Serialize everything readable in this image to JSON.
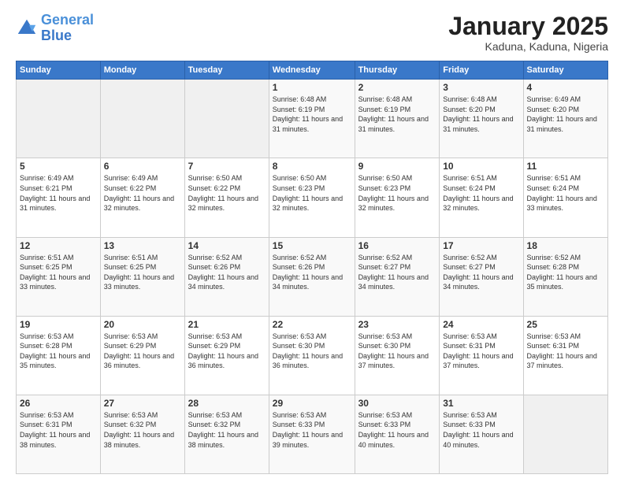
{
  "header": {
    "logo_general": "General",
    "logo_blue": "Blue",
    "title": "January 2025",
    "subtitle": "Kaduna, Kaduna, Nigeria"
  },
  "weekdays": [
    "Sunday",
    "Monday",
    "Tuesday",
    "Wednesday",
    "Thursday",
    "Friday",
    "Saturday"
  ],
  "weeks": [
    [
      {
        "day": "",
        "info": ""
      },
      {
        "day": "",
        "info": ""
      },
      {
        "day": "",
        "info": ""
      },
      {
        "day": "1",
        "info": "Sunrise: 6:48 AM\nSunset: 6:19 PM\nDaylight: 11 hours and 31 minutes."
      },
      {
        "day": "2",
        "info": "Sunrise: 6:48 AM\nSunset: 6:19 PM\nDaylight: 11 hours and 31 minutes."
      },
      {
        "day": "3",
        "info": "Sunrise: 6:48 AM\nSunset: 6:20 PM\nDaylight: 11 hours and 31 minutes."
      },
      {
        "day": "4",
        "info": "Sunrise: 6:49 AM\nSunset: 6:20 PM\nDaylight: 11 hours and 31 minutes."
      }
    ],
    [
      {
        "day": "5",
        "info": "Sunrise: 6:49 AM\nSunset: 6:21 PM\nDaylight: 11 hours and 31 minutes."
      },
      {
        "day": "6",
        "info": "Sunrise: 6:49 AM\nSunset: 6:22 PM\nDaylight: 11 hours and 32 minutes."
      },
      {
        "day": "7",
        "info": "Sunrise: 6:50 AM\nSunset: 6:22 PM\nDaylight: 11 hours and 32 minutes."
      },
      {
        "day": "8",
        "info": "Sunrise: 6:50 AM\nSunset: 6:23 PM\nDaylight: 11 hours and 32 minutes."
      },
      {
        "day": "9",
        "info": "Sunrise: 6:50 AM\nSunset: 6:23 PM\nDaylight: 11 hours and 32 minutes."
      },
      {
        "day": "10",
        "info": "Sunrise: 6:51 AM\nSunset: 6:24 PM\nDaylight: 11 hours and 32 minutes."
      },
      {
        "day": "11",
        "info": "Sunrise: 6:51 AM\nSunset: 6:24 PM\nDaylight: 11 hours and 33 minutes."
      }
    ],
    [
      {
        "day": "12",
        "info": "Sunrise: 6:51 AM\nSunset: 6:25 PM\nDaylight: 11 hours and 33 minutes."
      },
      {
        "day": "13",
        "info": "Sunrise: 6:51 AM\nSunset: 6:25 PM\nDaylight: 11 hours and 33 minutes."
      },
      {
        "day": "14",
        "info": "Sunrise: 6:52 AM\nSunset: 6:26 PM\nDaylight: 11 hours and 34 minutes."
      },
      {
        "day": "15",
        "info": "Sunrise: 6:52 AM\nSunset: 6:26 PM\nDaylight: 11 hours and 34 minutes."
      },
      {
        "day": "16",
        "info": "Sunrise: 6:52 AM\nSunset: 6:27 PM\nDaylight: 11 hours and 34 minutes."
      },
      {
        "day": "17",
        "info": "Sunrise: 6:52 AM\nSunset: 6:27 PM\nDaylight: 11 hours and 34 minutes."
      },
      {
        "day": "18",
        "info": "Sunrise: 6:52 AM\nSunset: 6:28 PM\nDaylight: 11 hours and 35 minutes."
      }
    ],
    [
      {
        "day": "19",
        "info": "Sunrise: 6:53 AM\nSunset: 6:28 PM\nDaylight: 11 hours and 35 minutes."
      },
      {
        "day": "20",
        "info": "Sunrise: 6:53 AM\nSunset: 6:29 PM\nDaylight: 11 hours and 36 minutes."
      },
      {
        "day": "21",
        "info": "Sunrise: 6:53 AM\nSunset: 6:29 PM\nDaylight: 11 hours and 36 minutes."
      },
      {
        "day": "22",
        "info": "Sunrise: 6:53 AM\nSunset: 6:30 PM\nDaylight: 11 hours and 36 minutes."
      },
      {
        "day": "23",
        "info": "Sunrise: 6:53 AM\nSunset: 6:30 PM\nDaylight: 11 hours and 37 minutes."
      },
      {
        "day": "24",
        "info": "Sunrise: 6:53 AM\nSunset: 6:31 PM\nDaylight: 11 hours and 37 minutes."
      },
      {
        "day": "25",
        "info": "Sunrise: 6:53 AM\nSunset: 6:31 PM\nDaylight: 11 hours and 37 minutes."
      }
    ],
    [
      {
        "day": "26",
        "info": "Sunrise: 6:53 AM\nSunset: 6:31 PM\nDaylight: 11 hours and 38 minutes."
      },
      {
        "day": "27",
        "info": "Sunrise: 6:53 AM\nSunset: 6:32 PM\nDaylight: 11 hours and 38 minutes."
      },
      {
        "day": "28",
        "info": "Sunrise: 6:53 AM\nSunset: 6:32 PM\nDaylight: 11 hours and 38 minutes."
      },
      {
        "day": "29",
        "info": "Sunrise: 6:53 AM\nSunset: 6:33 PM\nDaylight: 11 hours and 39 minutes."
      },
      {
        "day": "30",
        "info": "Sunrise: 6:53 AM\nSunset: 6:33 PM\nDaylight: 11 hours and 40 minutes."
      },
      {
        "day": "31",
        "info": "Sunrise: 6:53 AM\nSunset: 6:33 PM\nDaylight: 11 hours and 40 minutes."
      },
      {
        "day": "",
        "info": ""
      }
    ]
  ]
}
